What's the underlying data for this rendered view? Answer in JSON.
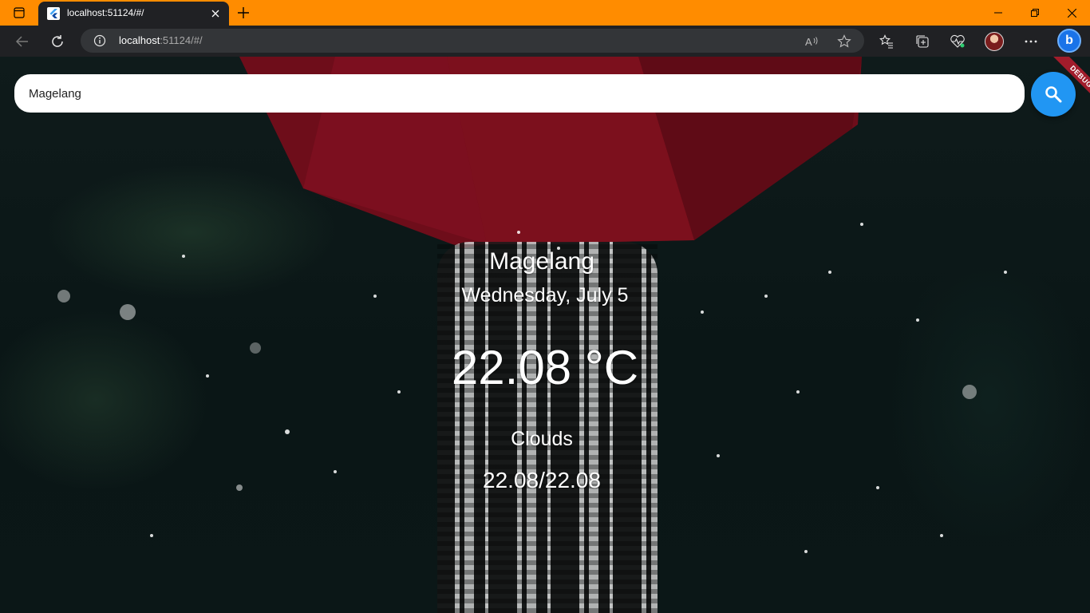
{
  "browser": {
    "tab": {
      "title": "localhost:51124/#/"
    },
    "address": {
      "host": "localhost",
      "rest": ":51124/#/"
    }
  },
  "app": {
    "search": {
      "value": "Magelang"
    },
    "debug_banner": "DEBUG",
    "weather": {
      "city": "Magelang",
      "date": "Wednesday, July 5",
      "temperature": "22.08 °C",
      "condition": "Clouds",
      "min_max": "22.08/22.08"
    }
  },
  "colors": {
    "titlebar": "#ff8c00",
    "search_button": "#2196f3",
    "debug_banner": "#a11c2b"
  }
}
